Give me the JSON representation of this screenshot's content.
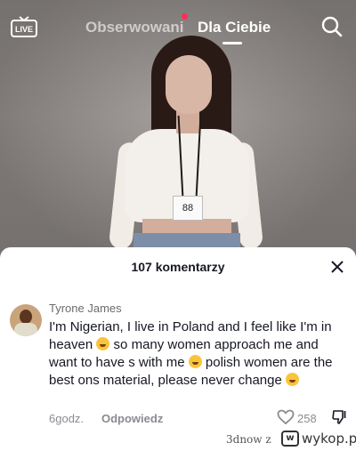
{
  "header": {
    "live_label": "LIVE",
    "tabs": [
      {
        "label": "Obserwowani",
        "active": false,
        "has_notification_dot": true
      },
      {
        "label": "Dla Ciebie",
        "active": true
      }
    ]
  },
  "video": {
    "badge_number": "88"
  },
  "comments": {
    "title": "107 komentarzy",
    "items": [
      {
        "username": "Tyrone James",
        "segments": [
          "I'm Nigerian, I live in Poland and I feel like I'm in heaven ",
          " so many women approach me and want to have s with me ",
          " polish women are the best ons material, please never change "
        ],
        "time": "6godz.",
        "reply_label": "Odpowiedz",
        "likes": "258"
      }
    ]
  },
  "watermark": {
    "user": "3dnow z",
    "brand": "wykop.pl"
  },
  "colors": {
    "notification_dot": "#ff2d55",
    "text_primary": "#161823",
    "text_secondary": "#8a8b91"
  }
}
